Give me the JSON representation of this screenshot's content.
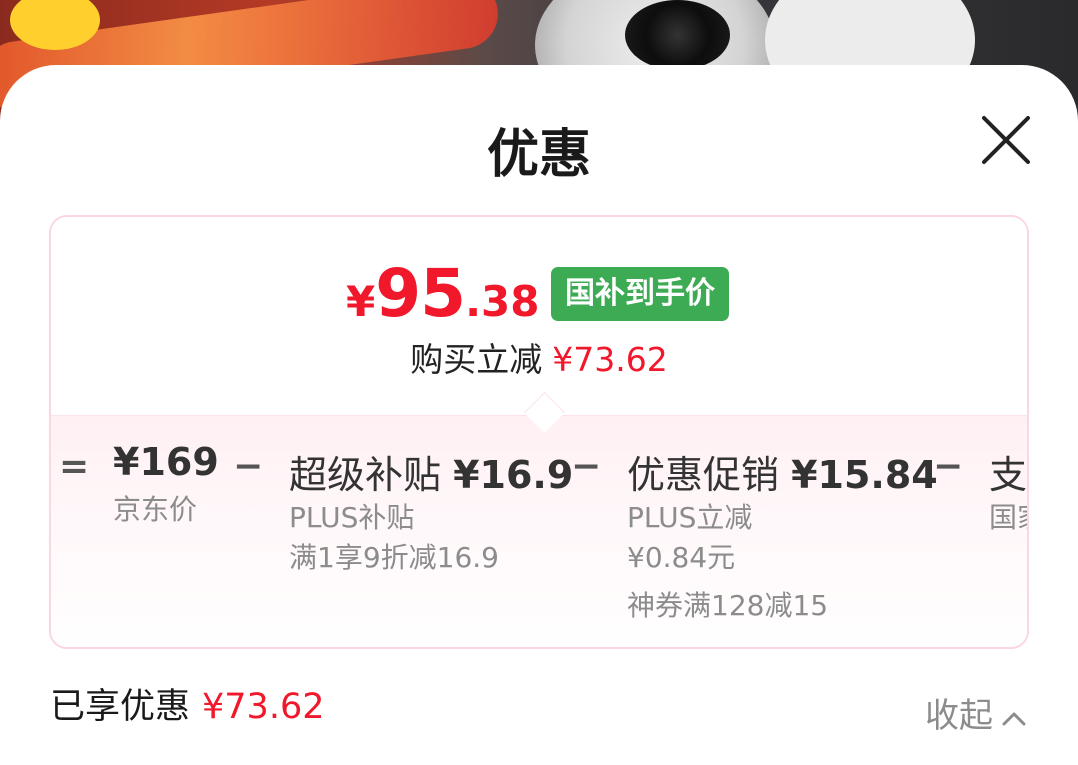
{
  "sheet": {
    "title": "优惠",
    "close_icon": "close-icon"
  },
  "price_card": {
    "currency": "¥",
    "price_integer": "95",
    "price_decimal": ".38",
    "badge": "国补到手价",
    "save_label": "购买立减",
    "save_value": "¥73.62",
    "accent_color": "#f0182a",
    "badge_color": "#3dab54"
  },
  "breakdown": {
    "equals": "=",
    "items": [
      {
        "amount": "¥169",
        "lines": [
          "京东价"
        ]
      },
      {
        "operator": "−",
        "label": "超级补贴",
        "amount": "¥16.9",
        "lines": [
          "PLUS补贴",
          "满1享9折减16.9"
        ]
      },
      {
        "operator": "−",
        "label": "优惠促销",
        "amount": "¥15.84",
        "lines": [
          "PLUS立减",
          "¥0.84元",
          "神券满128减15"
        ]
      },
      {
        "operator": "−",
        "label": "支付",
        "lines": [
          "国家"
        ]
      }
    ]
  },
  "footer": {
    "enjoyed_label": "已享优惠",
    "enjoyed_value": "¥73.62",
    "collapse_label": "收起",
    "collapse_icon": "chevron-up-icon"
  }
}
